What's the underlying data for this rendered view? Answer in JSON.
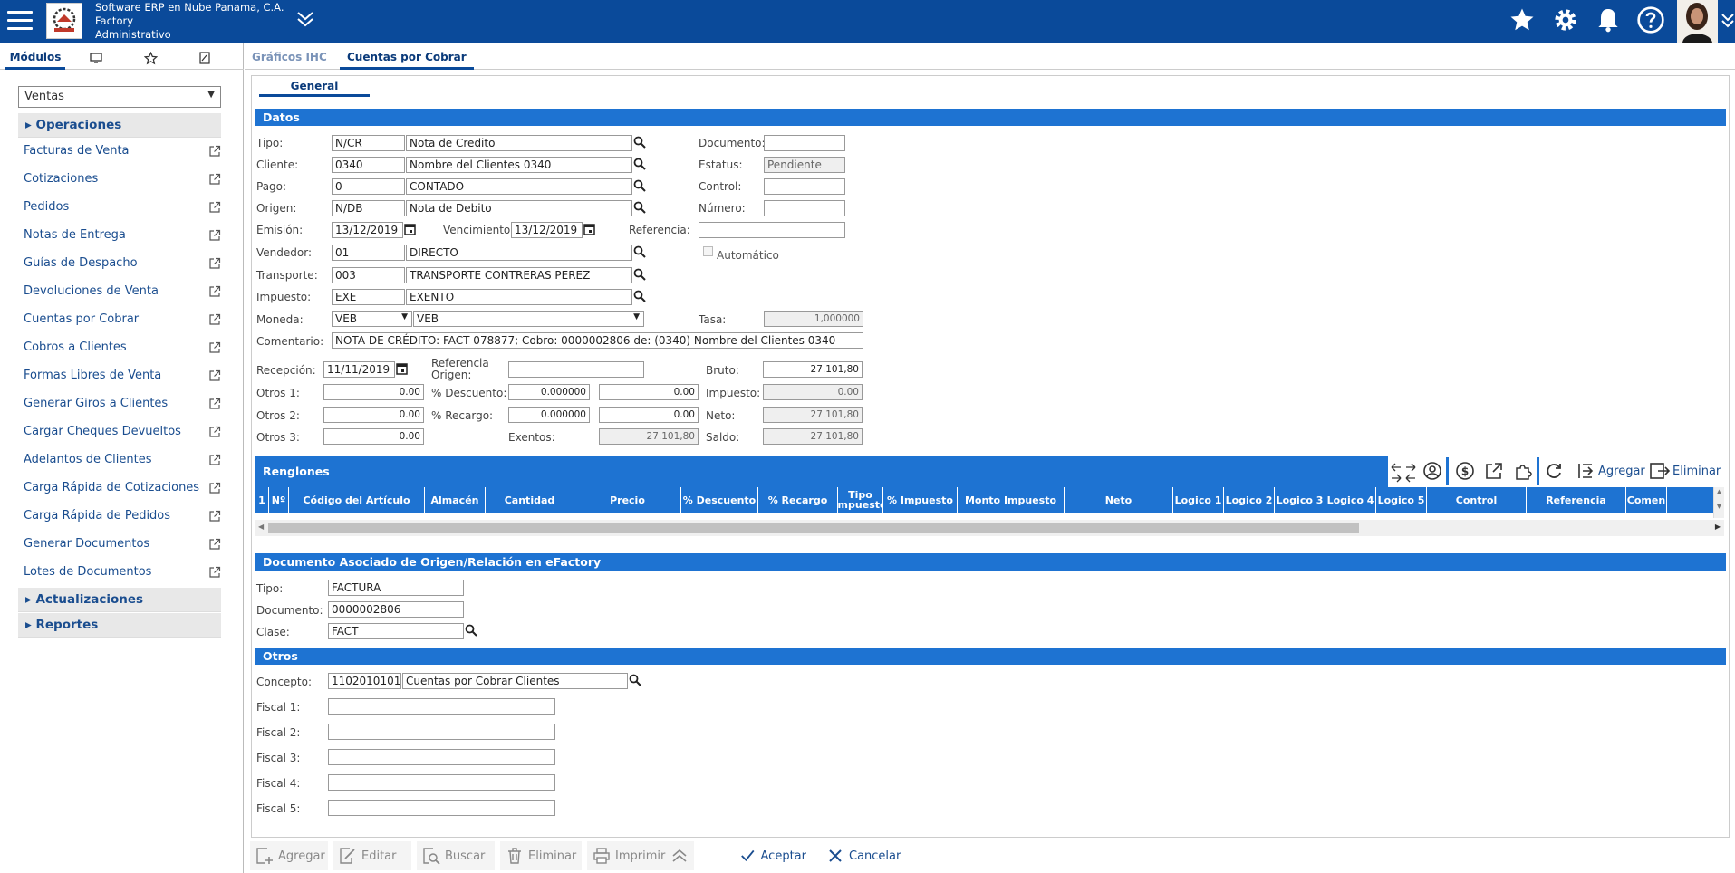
{
  "header": {
    "company_line1": "Software ERP en Nube Panama, C.A.",
    "company_line2": "Factory",
    "company_line3": "Administrativo",
    "icons": [
      "menu-icon",
      "logo",
      "chevrons-down-icon",
      "star-icon",
      "gear-icon",
      "bell-icon",
      "help-icon",
      "avatar"
    ]
  },
  "sidebar": {
    "tabs": [
      {
        "label": "Módulos",
        "icon": "modules"
      },
      {
        "label": "",
        "icon": "monitor-icon"
      },
      {
        "label": "",
        "icon": "star-icon"
      },
      {
        "label": "",
        "icon": "edit-icon"
      }
    ],
    "module_select": "Ventas",
    "sections": {
      "operaciones": "Operaciones",
      "actualizaciones": "Actualizaciones",
      "reportes": "Reportes"
    },
    "items": [
      "Facturas de Venta",
      "Cotizaciones",
      "Pedidos",
      "Notas de Entrega",
      "Guías de Despacho",
      "Devoluciones de Venta",
      "Cuentas por Cobrar",
      "Cobros a Clientes",
      "Formas Libres de Venta",
      "Generar Giros a Clientes",
      "Cargar Cheques Devueltos",
      "Adelantos de Clientes",
      "Carga Rápida de Cotizaciones",
      "Carga Rápida de Pedidos",
      "Generar Documentos",
      "Lotes de Documentos"
    ]
  },
  "tabs": {
    "graficos": "Gráficos IHC",
    "cxc": "Cuentas por Cobrar",
    "general": "General"
  },
  "datos": {
    "title": "Datos",
    "labels": {
      "tipo": "Tipo:",
      "cliente": "Cliente:",
      "pago": "Pago:",
      "origen": "Origen:",
      "emision": "Emisión:",
      "vencimiento": "Vencimiento:",
      "referencia": "Referencia:",
      "vendedor": "Vendedor:",
      "transporte": "Transporte:",
      "impuesto": "Impuesto:",
      "moneda": "Moneda:",
      "tasa": "Tasa:",
      "comentario": "Comentario:",
      "documento": "Documento:",
      "estatus": "Estatus:",
      "control": "Control:",
      "numero": "Número:",
      "automatico": "Automático",
      "recepcion": "Recepción:",
      "ref_origen": "Referencia Origen:",
      "bruto": "Bruto:",
      "otros1": "Otros 1:",
      "pct_descuento": "% Descuento:",
      "impuesto2": "Impuesto:",
      "otros2": "Otros 2:",
      "pct_recargo": "% Recargo:",
      "neto": "Neto:",
      "otros3": "Otros 3:",
      "exentos": "Exentos:",
      "saldo": "Saldo:"
    },
    "tipo_code": "N/CR",
    "tipo_desc": "Nota de Credito",
    "cliente_code": "0340",
    "cliente_desc": "Nombre del Clientes 0340",
    "pago_code": "0",
    "pago_desc": "CONTADO",
    "origen_code": "N/DB",
    "origen_desc": "Nota de Debito",
    "emision": "13/12/2019",
    "vencimiento": "13/12/2019",
    "referencia": "",
    "vendedor_code": "01",
    "vendedor_desc": "DIRECTO",
    "transporte_code": "003",
    "transporte_desc": "TRANSPORTE CONTRERAS PEREZ",
    "impuesto_code": "EXE",
    "impuesto_desc": "EXENTO",
    "moneda_code": "VEB",
    "moneda_desc": "VEB",
    "tasa": "1,000000",
    "comentario": "NOTA DE CRÉDITO: FACT 078877; Cobro: 0000002806 de: (0340) Nombre del Clientes 0340",
    "documento": "",
    "estatus": "Pendiente",
    "control": "",
    "numero": "",
    "recepcion": "11/11/2019",
    "ref_origen": "",
    "bruto": "27.101,80",
    "otros1": "0.00",
    "descuento_pct": "0.000000",
    "descuento_val": "0.00",
    "impuesto_val": "0.00",
    "otros2": "0.00",
    "recargo_pct": "0.000000",
    "recargo_val": "0.00",
    "neto": "27.101,80",
    "otros3": "0.00",
    "exentos": "27.101,80",
    "saldo": "27.101,80"
  },
  "renglones": {
    "title": "Renglones",
    "agregar": "Agregar",
    "eliminar": "Eliminar",
    "columns": [
      "1",
      "Nº",
      "Código del Artículo",
      "Almacén",
      "Cantidad",
      "Precio",
      "% Descuento",
      "% Recargo",
      "Tipo Impuesto",
      "% Impuesto",
      "Monto Impuesto",
      "Neto",
      "Logico 1",
      "Logico 2",
      "Logico 3",
      "Logico 4",
      "Logico 5",
      "Control",
      "Referencia",
      "Comen"
    ]
  },
  "doc_asociado": {
    "title": "Documento Asociado de Origen/Relación en eFactory",
    "labels": {
      "tipo": "Tipo:",
      "documento": "Documento:",
      "clase": "Clase:"
    },
    "tipo": "FACTURA",
    "documento": "0000002806",
    "clase": "FACT"
  },
  "otros": {
    "title": "Otros",
    "labels": {
      "concepto": "Concepto:",
      "fiscal1": "Fiscal 1:",
      "fiscal2": "Fiscal 2:",
      "fiscal3": "Fiscal 3:",
      "fiscal4": "Fiscal 4:",
      "fiscal5": "Fiscal 5:"
    },
    "concepto_code": "1102010101",
    "concepto_desc": "Cuentas por Cobrar Clientes",
    "fiscal1": "",
    "fiscal2": "",
    "fiscal3": "",
    "fiscal4": "",
    "fiscal5": ""
  },
  "toolbar": {
    "agregar": "Agregar",
    "editar": "Editar",
    "buscar": "Buscar",
    "eliminar": "Eliminar",
    "imprimir": "Imprimir",
    "aceptar": "Aceptar",
    "cancelar": "Cancelar"
  },
  "colors": {
    "header": "#0a4a9a",
    "section": "#1e73d2",
    "link": "#1a4d8f"
  }
}
